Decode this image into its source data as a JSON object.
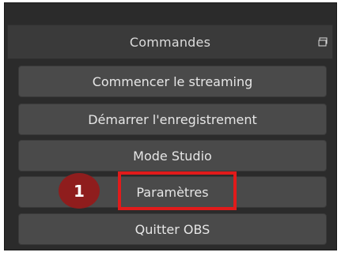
{
  "panel": {
    "title": "Commandes",
    "float_icon": "float-undock-icon"
  },
  "buttons": [
    {
      "label": "Commencer le streaming"
    },
    {
      "label": "Démarrer l'enregistrement"
    },
    {
      "label": "Mode Studio"
    },
    {
      "label": "Paramètres"
    },
    {
      "label": "Quitter OBS"
    }
  ],
  "annotation": {
    "badge_number": "1",
    "highlight_color": "#e11b1b",
    "badge_color": "#8f1d1d"
  }
}
